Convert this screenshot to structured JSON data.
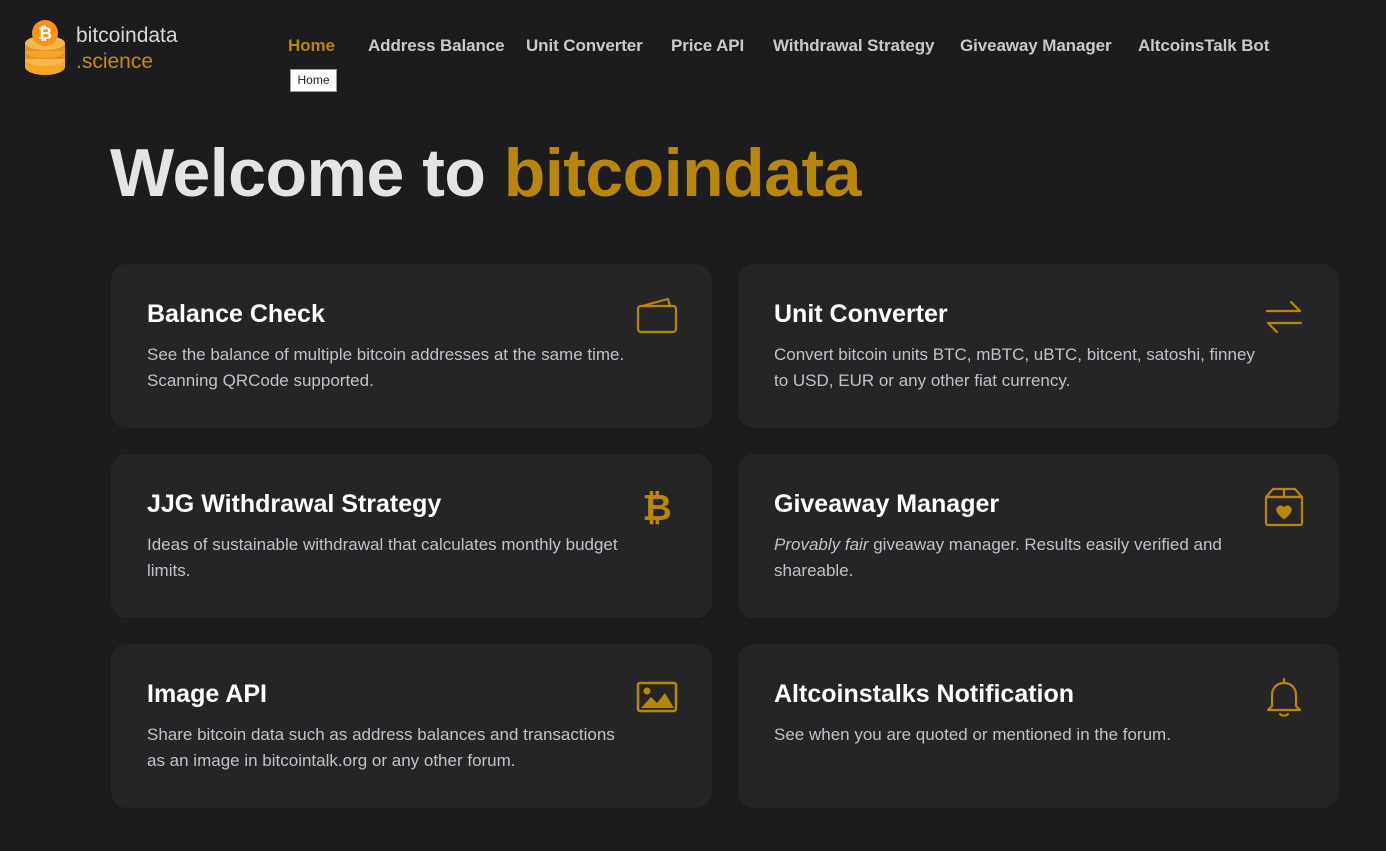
{
  "brand": {
    "line1": "bitcoindata",
    "line2": ".science"
  },
  "nav": {
    "items": [
      {
        "label": "Home",
        "active": true
      },
      {
        "label": "Address Balance"
      },
      {
        "label": "Unit Converter"
      },
      {
        "label": "Price API"
      },
      {
        "label": "Withdrawal Strategy"
      },
      {
        "label": "Giveaway Manager"
      },
      {
        "label": "AltcoinsTalk Bot"
      }
    ],
    "tooltip": "Home"
  },
  "hero": {
    "prefix": "Welcome to",
    "brand": "bitcoindata"
  },
  "cards": [
    {
      "title": "Balance Check",
      "desc": "See the balance of multiple bitcoin addresses at the same time. Scanning QRCode supported.",
      "icon": "wallet-icon"
    },
    {
      "title": "Unit Converter",
      "desc": "Convert bitcoin units BTC, mBTC, uBTC, bitcent, satoshi, finney to USD, EUR or any other fiat currency.",
      "icon": "swap-arrows-icon"
    },
    {
      "title": "JJG Withdrawal Strategy",
      "desc": "Ideas of sustainable withdrawal that calculates monthly budget limits.",
      "icon": "bitcoin-icon"
    },
    {
      "title": "Giveaway Manager",
      "desc_em": "Provably fair",
      "desc": " giveaway manager. Results easily verified and shareable.",
      "icon": "gift-box-heart-icon"
    },
    {
      "title": "Image API",
      "desc": "Share bitcoin data such as address balances and transactions as an image in bitcointalk.org or any other forum.",
      "icon": "image-icon"
    },
    {
      "title": "Altcoinstalks Notification",
      "desc": "See when you are quoted or mentioned in the forum.",
      "icon": "bell-icon"
    }
  ],
  "colors": {
    "accent": "#b8860b",
    "background": "#1c1c1e",
    "card": "#252527"
  }
}
